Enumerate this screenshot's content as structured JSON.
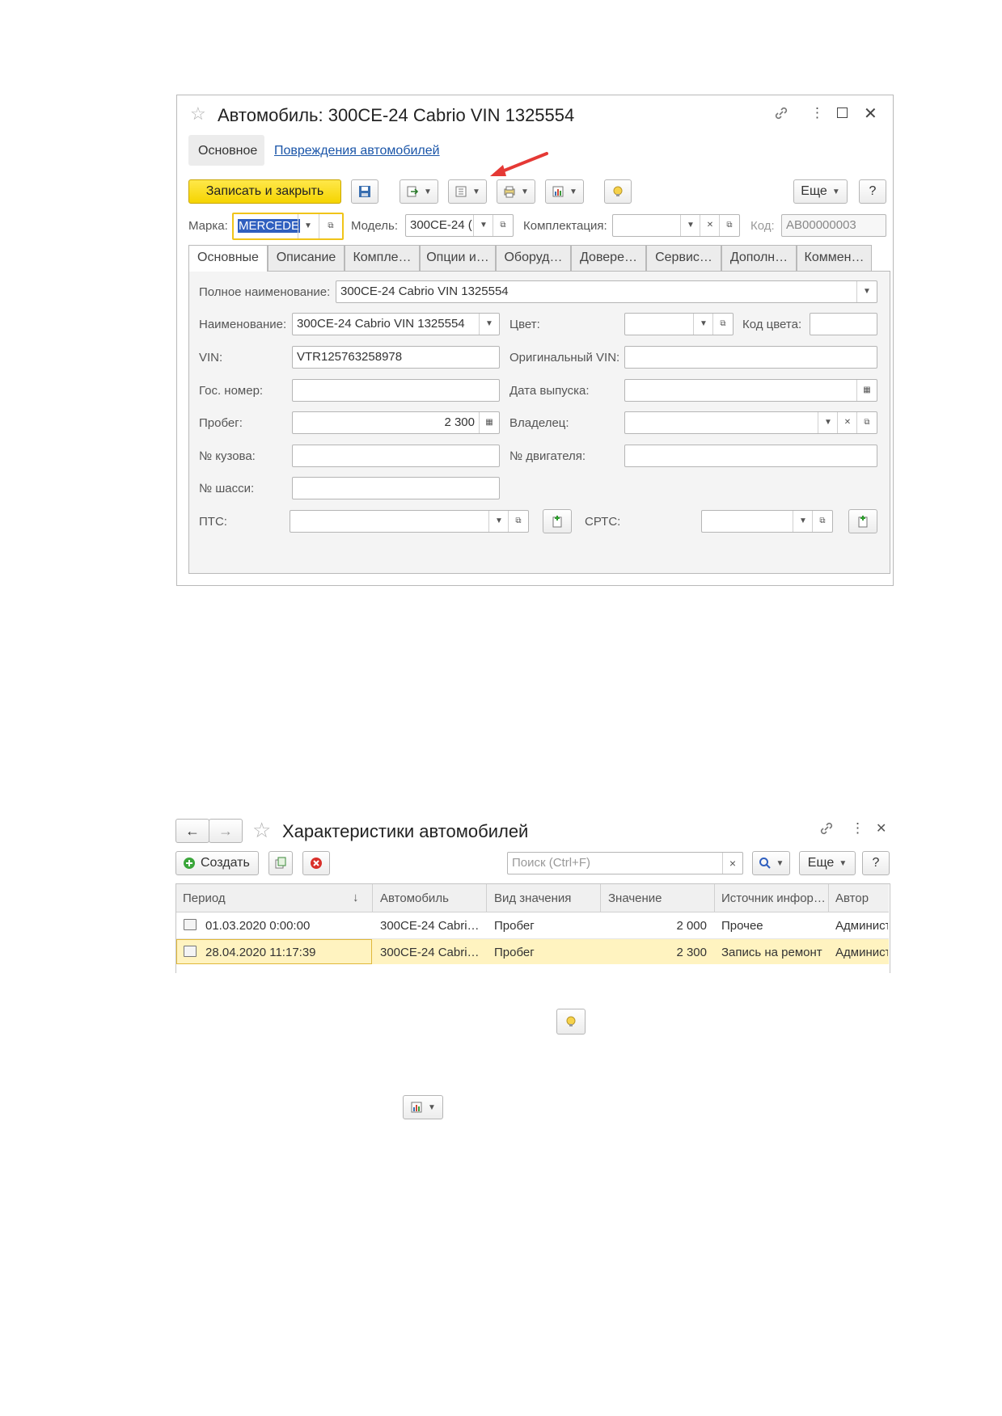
{
  "form1": {
    "title": "Автомобиль: 300CE-24 Cabrio VIN 1325554",
    "nav_tabs": [
      "Основное",
      "Повреждения автомобилей"
    ],
    "toolbar": {
      "save_close": "Записать и закрыть",
      "more": "Еще",
      "help": "?"
    },
    "header_fields": {
      "brand_label": "Марка:",
      "brand_value": "MERCEDE",
      "model_label": "Модель:",
      "model_value": "300CE-24 (",
      "config_label": "Комплектация:",
      "config_value": "",
      "code_label": "Код:",
      "code_value": "АВ00000003"
    },
    "tabs": [
      "Основные",
      "Описание",
      "Компле…",
      "Опции и…",
      "Оборуд…",
      "Довере…",
      "Сервис…",
      "Дополн…",
      "Коммен…"
    ],
    "fields": {
      "full_name_label": "Полное наименование:",
      "full_name_value": "300CE-24 Cabrio VIN 1325554",
      "name_label": "Наименование:",
      "name_value": "300CE-24 Cabrio VIN 1325554",
      "color_label": "Цвет:",
      "color_value": "",
      "color_code_label": "Код цвета:",
      "color_code_value": "",
      "vin_label": "VIN:",
      "vin_value": "VTR125763258978",
      "orig_vin_label": "Оригинальный VIN:",
      "orig_vin_value": "",
      "plate_label": "Гос. номер:",
      "plate_value": "",
      "release_label": "Дата выпуска:",
      "release_value": "",
      "mileage_label": "Пробег:",
      "mileage_value": "2 300",
      "owner_label": "Владелец:",
      "owner_value": "",
      "body_label": "№ кузова:",
      "body_value": "",
      "engine_label": "№ двигателя:",
      "engine_value": "",
      "chassis_label": "№ шасси:",
      "chassis_value": "",
      "pts_label": "ПТС:",
      "pts_value": "",
      "srts_label": "СРТС:",
      "srts_value": ""
    }
  },
  "form2": {
    "title": "Характеристики автомобилей",
    "toolbar": {
      "create": "Создать",
      "search_placeholder": "Поиск (Ctrl+F)",
      "more": "Еще",
      "help": "?",
      "clear": "×"
    },
    "columns": [
      "Период",
      "Автомобиль",
      "Вид значения",
      "Значение",
      "Источник инфор…",
      "Автор"
    ],
    "sort_indicator": "↓",
    "rows": [
      {
        "period": "01.03.2020 0:00:00",
        "car": "300CE-24 Cabri…",
        "kind": "Пробег",
        "value": "2 000",
        "source": "Прочее",
        "author": "Администратор"
      },
      {
        "period": "28.04.2020 11:17:39",
        "car": "300CE-24 Cabri…",
        "kind": "Пробег",
        "value": "2 300",
        "source": "Запись на ремонт",
        "author": "Администратор"
      }
    ]
  },
  "colors": {
    "accent_yellow": "#f5d400",
    "selected_row": "#fff3c0",
    "link": "#1a55a8",
    "arrow": "#e53935"
  }
}
